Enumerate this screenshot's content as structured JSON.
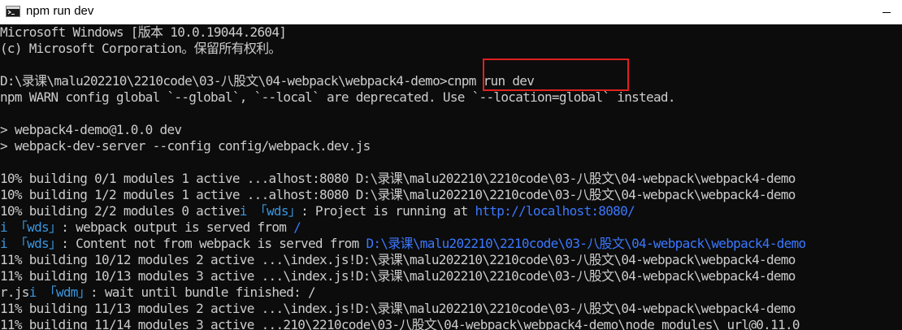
{
  "window": {
    "title": "npm run dev",
    "icon": "console-icon",
    "minimize_glyph": "minimize-icon"
  },
  "console": {
    "lines": [
      {
        "segments": [
          {
            "text": "Microsoft Windows [版本 10.0.19044.2604]",
            "color": "gray"
          }
        ]
      },
      {
        "segments": [
          {
            "text": "(c) Microsoft Corporation。保留所有权利。",
            "color": "gray"
          }
        ]
      },
      {
        "segments": [
          {
            "text": "",
            "color": "gray"
          }
        ]
      },
      {
        "segments": [
          {
            "text": "D:\\录课\\malu202210\\2210code\\03-八股文\\04-webpack\\webpack4-demo>cnpm run dev",
            "color": "gray"
          }
        ]
      },
      {
        "segments": [
          {
            "text": "npm WARN config global `--global`, `--local` are deprecated. Use `--location=global` instead.",
            "color": "gray"
          }
        ]
      },
      {
        "segments": [
          {
            "text": "",
            "color": "gray"
          }
        ]
      },
      {
        "segments": [
          {
            "text": "> webpack4-demo@1.0.0 dev",
            "color": "gray"
          }
        ]
      },
      {
        "segments": [
          {
            "text": "> webpack-dev-server --config config/webpack.dev.js",
            "color": "gray"
          }
        ]
      },
      {
        "segments": [
          {
            "text": "",
            "color": "gray"
          }
        ]
      },
      {
        "segments": [
          {
            "text": "10% building 0/1 modules 1 active ...alhost:8080 D:\\录课\\malu202210\\2210code\\03-八股文\\04-webpack\\webpack4-demo",
            "color": "gray"
          }
        ]
      },
      {
        "segments": [
          {
            "text": "10% building 1/2 modules 1 active ...alhost:8080 D:\\录课\\malu202210\\2210code\\03-八股文\\04-webpack\\webpack4-demo",
            "color": "gray"
          }
        ]
      },
      {
        "segments": [
          {
            "text": "10% building 2/2 modules 0 active",
            "color": "gray"
          },
          {
            "text": "i 「wds」",
            "color": "blue"
          },
          {
            "text": ": Project is running at ",
            "color": "gray"
          },
          {
            "text": "http://localhost:8080/",
            "color": "link"
          }
        ]
      },
      {
        "segments": [
          {
            "text": "i 「wds」",
            "color": "blue"
          },
          {
            "text": ": webpack output is served from ",
            "color": "gray"
          },
          {
            "text": "/",
            "color": "link"
          }
        ]
      },
      {
        "segments": [
          {
            "text": "i 「wds」",
            "color": "blue"
          },
          {
            "text": ": Content not from webpack is served from ",
            "color": "gray"
          },
          {
            "text": "D:\\录课\\malu202210\\2210code\\03-八股文\\04-webpack\\webpack4-demo",
            "color": "link"
          }
        ]
      },
      {
        "segments": [
          {
            "text": "11% building 10/12 modules 2 active ...\\index.js!D:\\录课\\malu202210\\2210code\\03-八股文\\04-webpack\\webpack4-demo",
            "color": "gray"
          }
        ]
      },
      {
        "segments": [
          {
            "text": "11% building 10/13 modules 3 active ...\\index.js!D:\\录课\\malu202210\\2210code\\03-八股文\\04-webpack\\webpack4-demo",
            "color": "gray"
          }
        ]
      },
      {
        "segments": [
          {
            "text": "r.js",
            "color": "gray"
          },
          {
            "text": "i 「wdm」",
            "color": "blue"
          },
          {
            "text": ": wait until bundle finished: /",
            "color": "gray"
          }
        ]
      },
      {
        "segments": [
          {
            "text": "11% building 11/13 modules 2 active ...\\index.js!D:\\录课\\malu202210\\2210code\\03-八股文\\04-webpack\\webpack4-demo",
            "color": "gray"
          }
        ]
      },
      {
        "segments": [
          {
            "text": "11% building 11/14 modules 3 active ...210\\2210code\\03-八股文\\04-webpack\\webpack4-demo\\node_modules\\_url@0.11.0",
            "color": "gray"
          }
        ]
      }
    ]
  },
  "colors": {
    "background": "#0c0c0c",
    "text": "#cccccc",
    "info_blue": "#3a96dd",
    "link_blue": "#3b78ff",
    "highlight": "#e02020"
  }
}
